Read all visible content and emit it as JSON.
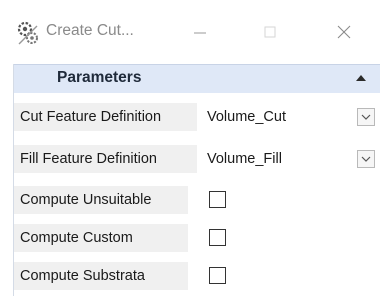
{
  "window": {
    "title": "Create Cut...",
    "icon": "cut-fill-gears-icon"
  },
  "panel": {
    "section_title": "Parameters",
    "collapse_icon": "chevron-up-icon",
    "rows": [
      {
        "label": "Cut Feature Definition",
        "value": "Volume_Cut",
        "control": "dropdown"
      },
      {
        "label": "Fill Feature Definition",
        "value": "Volume_Fill",
        "control": "dropdown"
      },
      {
        "label": "Compute Unsuitable",
        "checked": false,
        "control": "checkbox"
      },
      {
        "label": "Compute Custom",
        "checked": false,
        "control": "checkbox"
      },
      {
        "label": "Compute Substrata",
        "checked": false,
        "control": "checkbox"
      }
    ]
  },
  "colors": {
    "section_header_bg": "#dfe8f7",
    "title_text": "#8a8a8a"
  }
}
